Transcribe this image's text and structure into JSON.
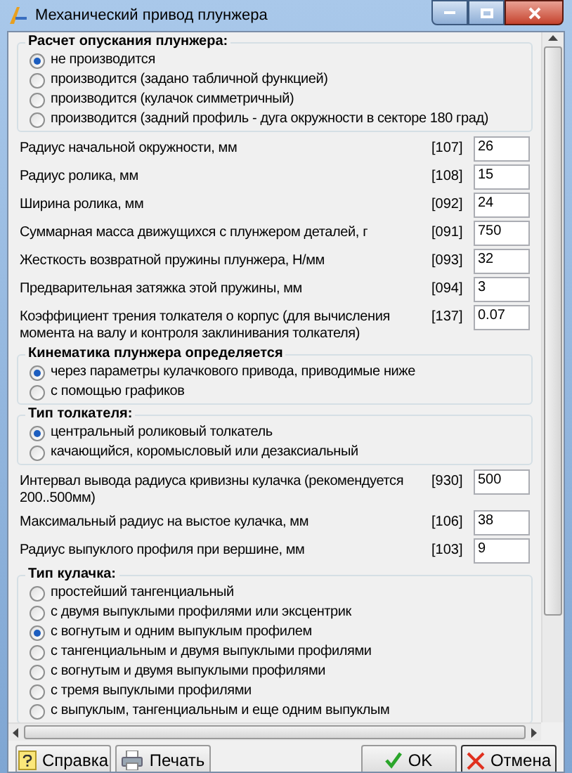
{
  "window": {
    "title": "Механический привод плунжера"
  },
  "sections": [
    {
      "kind": "radio_group",
      "title": "Расчет опускания плунжера:",
      "options": [
        {
          "label": "не производится",
          "selected": true
        },
        {
          "label": "производится (задано табличной функцией)",
          "selected": false
        },
        {
          "label": "производится (кулачок симметричный)",
          "selected": false
        },
        {
          "label": "производится (задний профиль - дуга окружности в секторе 180 град)",
          "selected": false
        }
      ]
    },
    {
      "kind": "field",
      "label": "Радиус начальной окружности, мм",
      "code": "[107]",
      "value": "26"
    },
    {
      "kind": "field",
      "label": "Радиус ролика, мм",
      "code": "[108]",
      "value": "15"
    },
    {
      "kind": "field",
      "label": "Ширина ролика, мм",
      "code": "[092]",
      "value": "24"
    },
    {
      "kind": "field",
      "label": "Суммарная масса движущихся с плунжером деталей, г",
      "code": "[091]",
      "value": "750"
    },
    {
      "kind": "field",
      "label": "Жесткость возвратной пружины плунжера, Н/мм",
      "code": "[093]",
      "value": "32"
    },
    {
      "kind": "field",
      "label": "Предварительная затяжка этой пружины, мм",
      "code": "[094]",
      "value": "3"
    },
    {
      "kind": "field",
      "label": "Коэффициент трения толкателя о корпус (для вычисления момента на валу и контроля заклинивания толкателя)",
      "code": "[137]",
      "value": "0.07"
    },
    {
      "kind": "radio_group",
      "title": "Кинематика плунжера определяется",
      "options": [
        {
          "label": "через параметры кулачкового привода, приводимые ниже",
          "selected": true
        },
        {
          "label": "с помощью графиков",
          "selected": false
        }
      ]
    },
    {
      "kind": "radio_group",
      "title": "Тип толкателя:",
      "options": [
        {
          "label": "центральный роликовый толкатель",
          "selected": true
        },
        {
          "label": "качающийся, коромысловый или дезаксиальный",
          "selected": false
        }
      ]
    },
    {
      "kind": "field",
      "label": "Интервал вывода радиуса кривизны кулачка (рекомендуется 200..500мм)",
      "code": "[930]",
      "value": "500"
    },
    {
      "kind": "field",
      "label": "Максимальный радиус на выстое кулачка, мм",
      "code": "[106]",
      "value": "38"
    },
    {
      "kind": "field",
      "label": "Радиус выпуклого профиля при вершине, мм",
      "code": "[103]",
      "value": "9"
    },
    {
      "kind": "radio_group",
      "title": "Тип кулачка:",
      "options": [
        {
          "label": "простейший тангенциальный",
          "selected": false
        },
        {
          "label": "с двумя выпуклыми профилями или эксцентрик",
          "selected": false
        },
        {
          "label": "с вогнутым и одним выпуклым профилем",
          "selected": true
        },
        {
          "label": "с тангенциальным и двумя выпуклыми профилями",
          "selected": false
        },
        {
          "label": "с вогнутым и двумя выпуклыми профилями",
          "selected": false
        },
        {
          "label": "с тремя выпуклыми профилями",
          "selected": false
        },
        {
          "label": "с выпуклым, тангенциальным и еще одним выпуклым",
          "selected": false
        }
      ]
    }
  ],
  "buttons": [
    {
      "kind": "help",
      "label": "Справка"
    },
    {
      "kind": "print",
      "label": "Печать"
    },
    {
      "kind": "ok",
      "label": "OK"
    },
    {
      "kind": "cancel",
      "label": "Отмена"
    }
  ]
}
